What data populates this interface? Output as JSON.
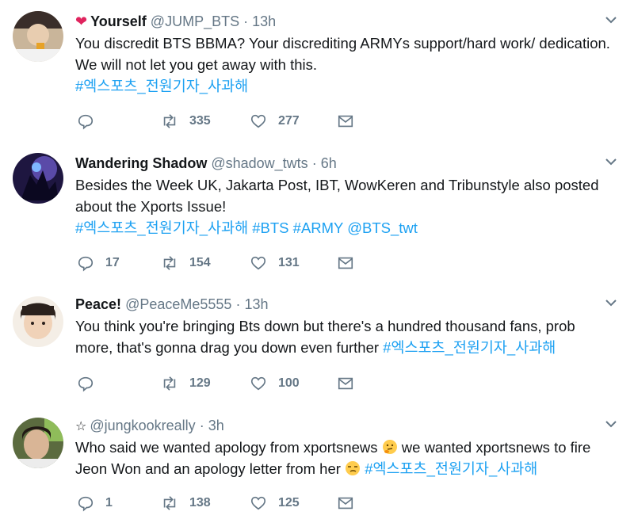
{
  "tweets": [
    {
      "badge": "heart",
      "name": "Yourself",
      "handle": "@JUMP_BTS",
      "dot": "·",
      "time": "13h",
      "lines": [
        [
          {
            "t": "You discredit BTS BBMA? Your discrediting ARMYs support/hard work/ dedication.",
            "h": false
          }
        ],
        [
          {
            "t": "We will not let you get away with this.",
            "h": false
          }
        ],
        [
          {
            "t": "#엑스포츠_전원기자_사과해",
            "h": true
          }
        ]
      ],
      "reply_count": "",
      "retweet_count": "335",
      "like_count": "277"
    },
    {
      "badge": "",
      "name": "Wandering Shadow",
      "handle": "@shadow_twts",
      "dot": "·",
      "time": "6h",
      "lines": [
        [
          {
            "t": "Besides the Week UK, Jakarta Post, IBT, WowKeren and Tribunstyle also posted",
            "h": false
          }
        ],
        [
          {
            "t": "about the Xports Issue!",
            "h": false
          }
        ],
        [
          {
            "t": "#엑스포츠_전원기자_사과해",
            "h": true
          },
          {
            "t": " ",
            "h": false
          },
          {
            "t": "#BTS",
            "h": true
          },
          {
            "t": " ",
            "h": false
          },
          {
            "t": "#ARMY",
            "h": true
          },
          {
            "t": " ",
            "h": false
          },
          {
            "t": "@BTS_twt",
            "h": true
          }
        ]
      ],
      "reply_count": "17",
      "retweet_count": "154",
      "like_count": "131"
    },
    {
      "badge": "",
      "name": "Peace!",
      "handle": "@PeaceMe5555",
      "dot": "·",
      "time": "13h",
      "lines": [
        [
          {
            "t": "You think you're bringing Bts down but there's a hundred thousand fans, prob",
            "h": false
          }
        ],
        [
          {
            "t": "more, that's gonna drag you down even further ",
            "h": false
          },
          {
            "t": "#엑스포츠_전원기자_사과해",
            "h": true
          }
        ]
      ],
      "reply_count": "",
      "retweet_count": "129",
      "like_count": "100"
    },
    {
      "badge": "star",
      "name": "",
      "handle": "@jungkookreally",
      "dot": "·",
      "time": "3h",
      "lines": [
        [
          {
            "t": "Who said we wanted apology from xportsnews ",
            "h": false
          },
          {
            "e": "thinking-face"
          },
          {
            "t": " we wanted xportsnews to fire",
            "h": false
          }
        ],
        [
          {
            "t": "Jeon Won and an apology letter from her ",
            "h": false
          },
          {
            "e": "unamused-face"
          },
          {
            "t": " ",
            "h": false
          },
          {
            "t": "#엑스포츠_전원기자_사과해",
            "h": true
          }
        ]
      ],
      "reply_count": "1",
      "retweet_count": "138",
      "like_count": "125"
    }
  ],
  "colors": {
    "link": "#1da1f2",
    "muted": "#657786",
    "text": "#14171a",
    "heart": "#e0245e"
  }
}
